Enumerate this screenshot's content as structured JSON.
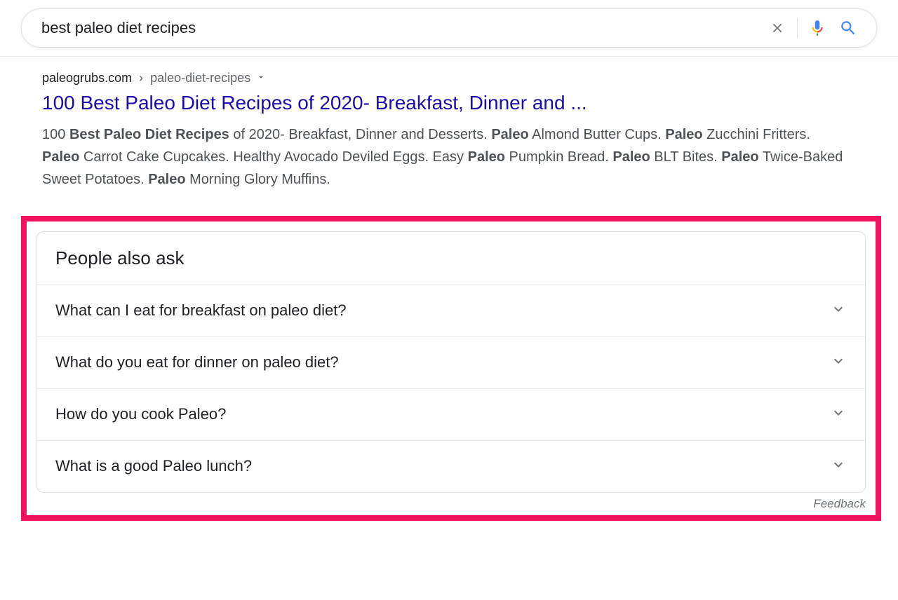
{
  "search": {
    "query": "best paleo diet recipes"
  },
  "result": {
    "url_domain": "paleogrubs.com",
    "url_separator": "›",
    "url_path": "paleo-diet-recipes",
    "title": "100 Best Paleo Diet Recipes of 2020- Breakfast, Dinner and ...",
    "snippet_html": "100 <b>Best Paleo Diet Recipes</b> of 2020- Breakfast, Dinner and Desserts. <b>Paleo</b> Almond Butter Cups. <b>Paleo</b> Zucchini Fritters. <b>Paleo</b> Carrot Cake Cupcakes. Healthy Avocado Deviled Eggs. Easy <b>Paleo</b> Pumpkin Bread. <b>Paleo</b> BLT Bites. <b>Paleo</b> Twice-Baked Sweet Potatoes. <b>Paleo</b> Morning Glory Muffins."
  },
  "paa": {
    "header": "People also ask",
    "questions": [
      "What can I eat for breakfast on paleo diet?",
      "What do you eat for dinner on paleo diet?",
      "How do you cook Paleo?",
      "What is a good Paleo lunch?"
    ],
    "feedback": "Feedback"
  }
}
